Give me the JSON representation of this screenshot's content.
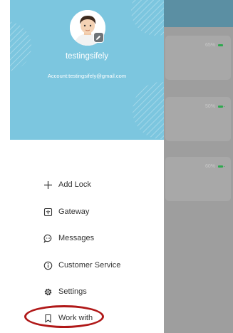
{
  "user": {
    "name": "testingsifely",
    "account": "Account:testingsifely@gmail.com"
  },
  "menu": [
    {
      "label": "Add Lock",
      "icon": "plus-icon"
    },
    {
      "label": "Gateway",
      "icon": "gateway-icon"
    },
    {
      "label": "Messages",
      "icon": "message-bubble-icon"
    },
    {
      "label": "Customer Service",
      "icon": "info-circle-icon"
    },
    {
      "label": "Settings",
      "icon": "gear-icon"
    },
    {
      "label": "Work with",
      "icon": "bookmark-icon"
    }
  ],
  "background_locks": [
    {
      "battery": "65%"
    },
    {
      "battery": "50%"
    },
    {
      "battery": "60%"
    }
  ],
  "colors": {
    "header": "#7cc6df",
    "highlight": "#b01818",
    "battery": "#2fa84f"
  }
}
